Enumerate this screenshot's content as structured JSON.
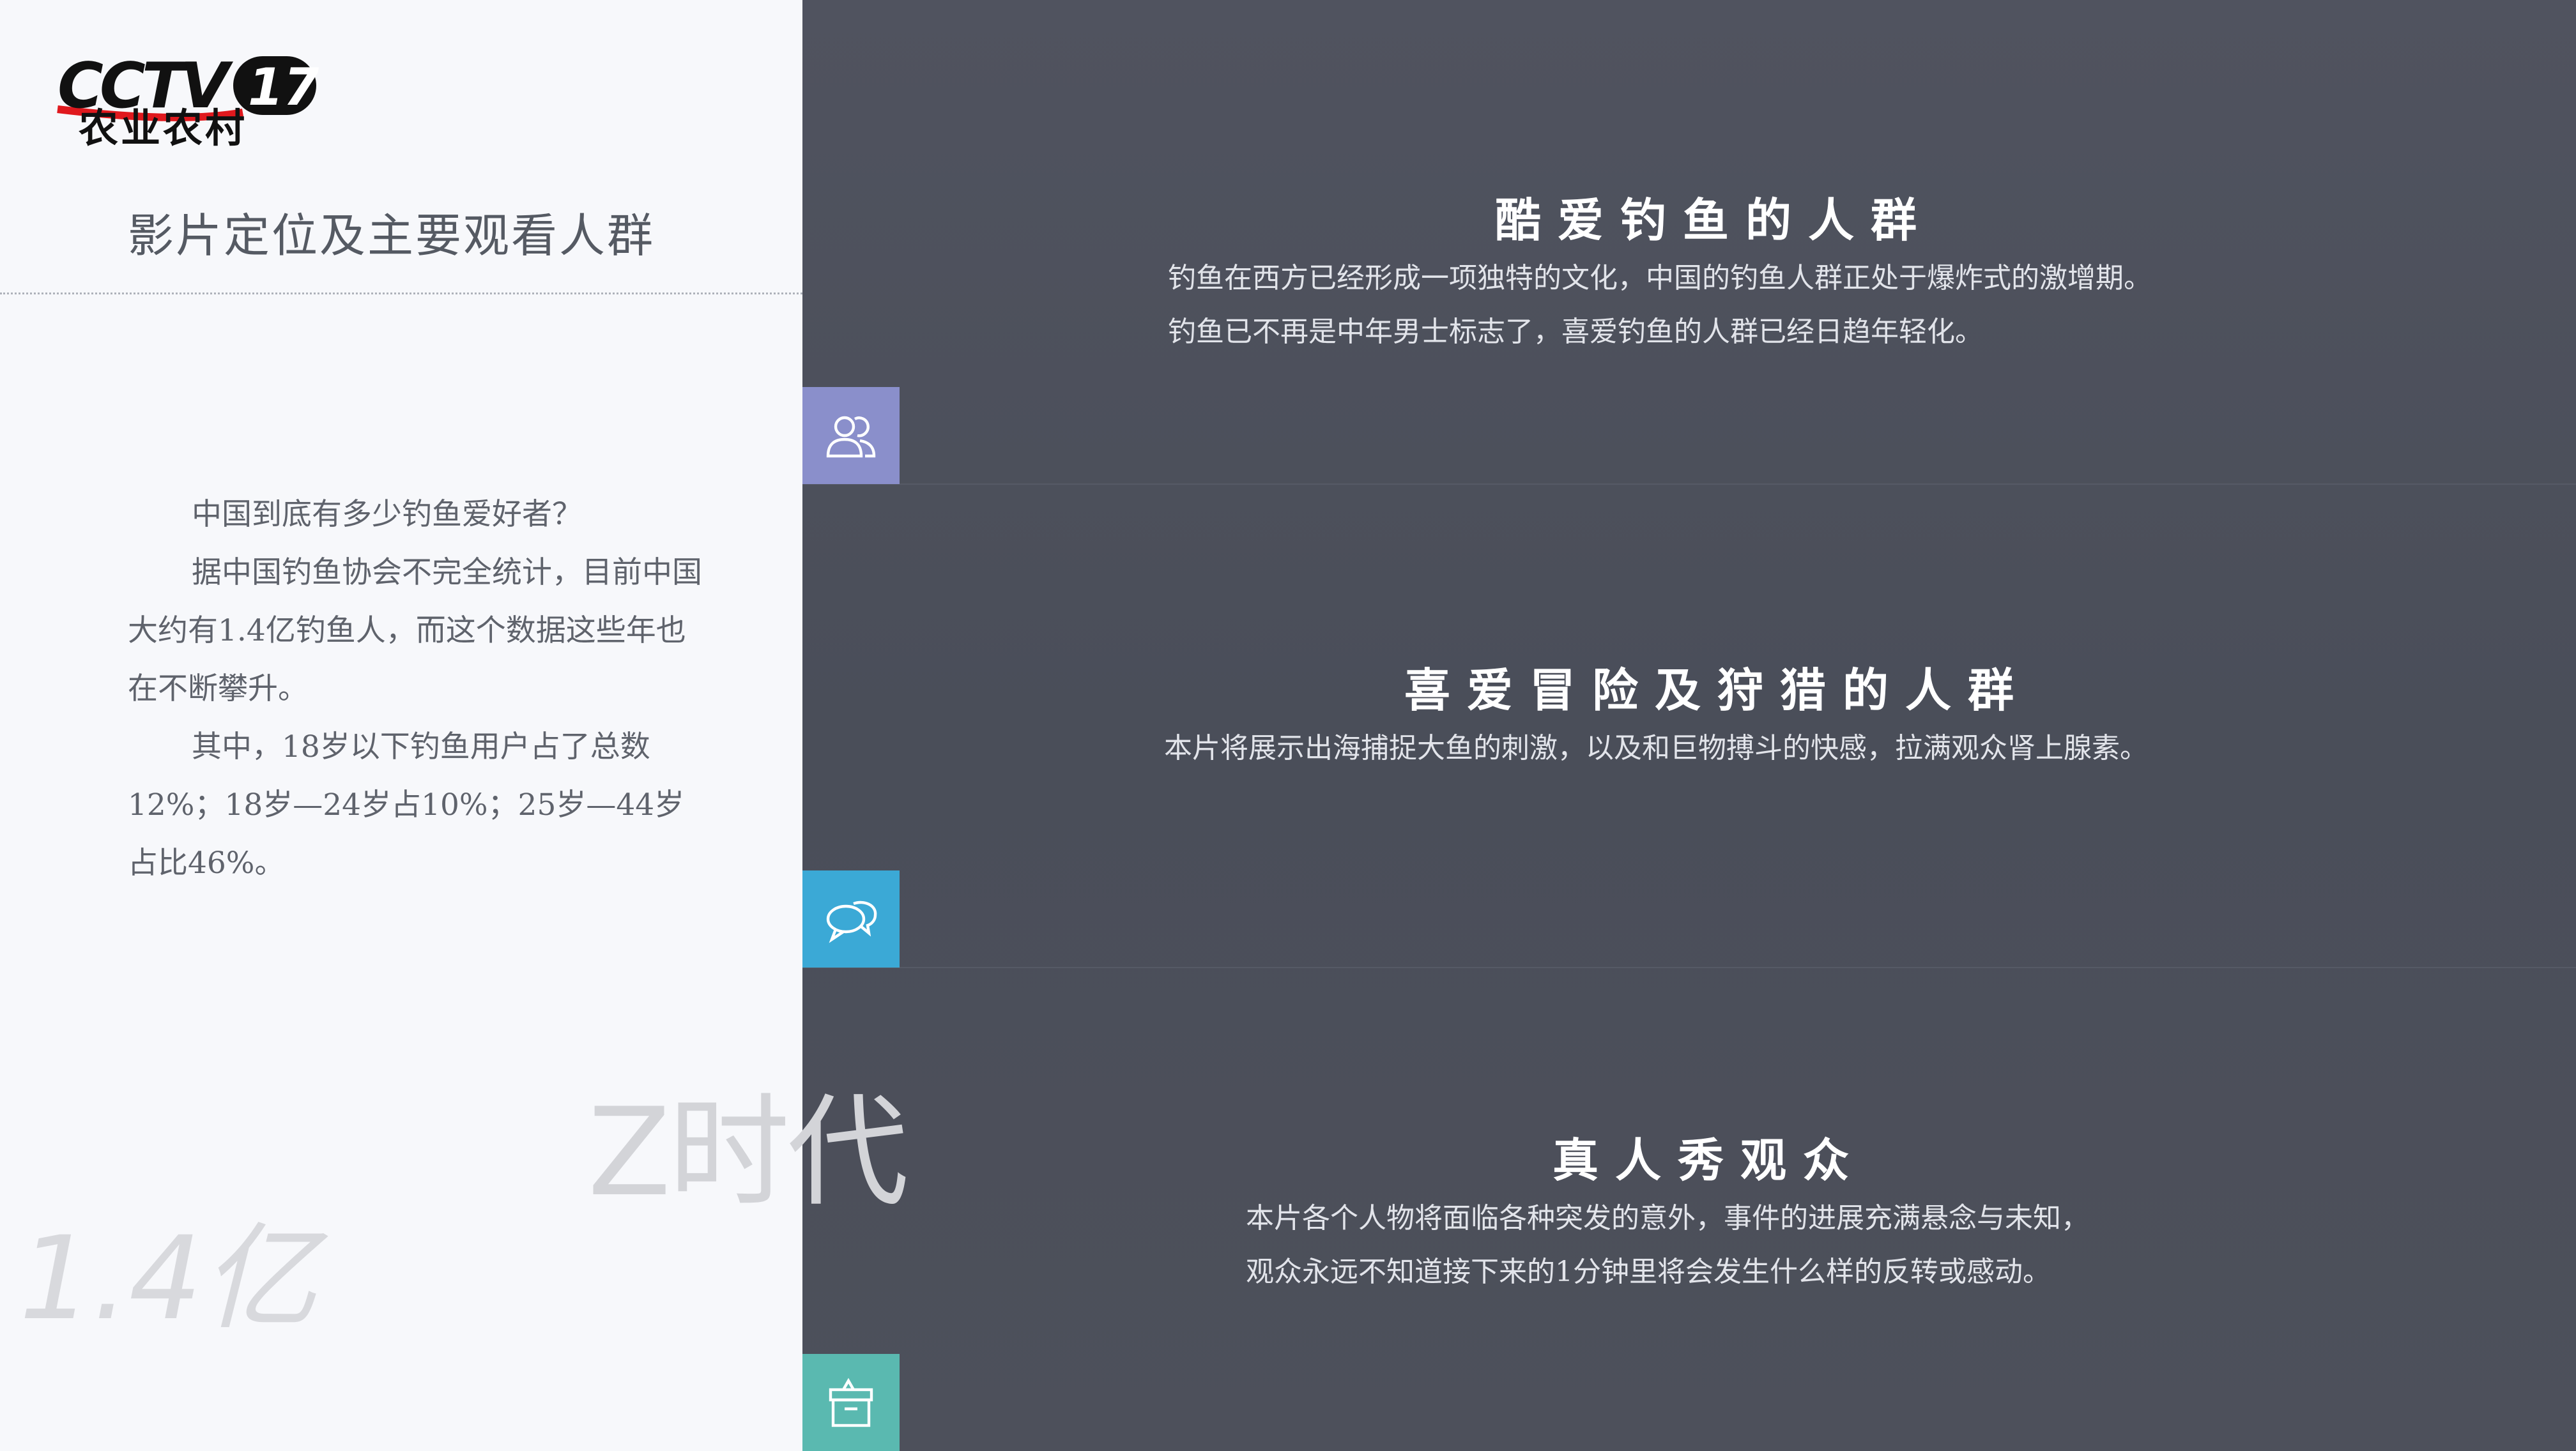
{
  "logo": {
    "brand": "CCTV",
    "channel": "17",
    "subtitle": "农业农村"
  },
  "left": {
    "title": "影片定位及主要观看人群",
    "paragraphs": [
      "中国到底有多少钓鱼爱好者？",
      "据中国钓鱼协会不完全统计，目前中国大约有1.4亿钓鱼人，而这个数据这些年也在不断攀升。",
      "其中，18岁以下钓鱼用户占了总数12%；18岁—24岁占10%；25岁—44岁占比46%。"
    ],
    "ghost_z": "Z时代",
    "ghost_number": "1.4亿"
  },
  "blocks": [
    {
      "title": "酷爱钓鱼的人群",
      "lines": [
        "钓鱼在西方已经形成一项独特的文化，中国的钓鱼人群正处于爆炸式的激增期。",
        "钓鱼已不再是中年男士标志了，喜爱钓鱼的人群已经日趋年轻化。"
      ],
      "icon": "users-icon",
      "icon_color": "#8a8fcb"
    },
    {
      "title": "喜爱冒险及狩猎的人群",
      "lines": [
        "本片将展示出海捕捉大鱼的刺激，以及和巨物搏斗的快感，拉满观众肾上腺素。"
      ],
      "icon": "chat-bubbles-icon",
      "icon_color": "#3ba9d6"
    },
    {
      "title": "真人秀观众",
      "lines": [
        "本片各个人物将面临各种突发的意外，事件的进展充满悬念与未知，",
        "观众永远不知道接下来的1分钟里将会发生什么样的反转或感动。"
      ],
      "icon": "gift-box-icon",
      "icon_color": "#5ab9b0"
    }
  ],
  "colors": {
    "left_bg": "#f7f8fb",
    "right_bg": "#4b4f5a",
    "logo_red": "#e0191e"
  }
}
